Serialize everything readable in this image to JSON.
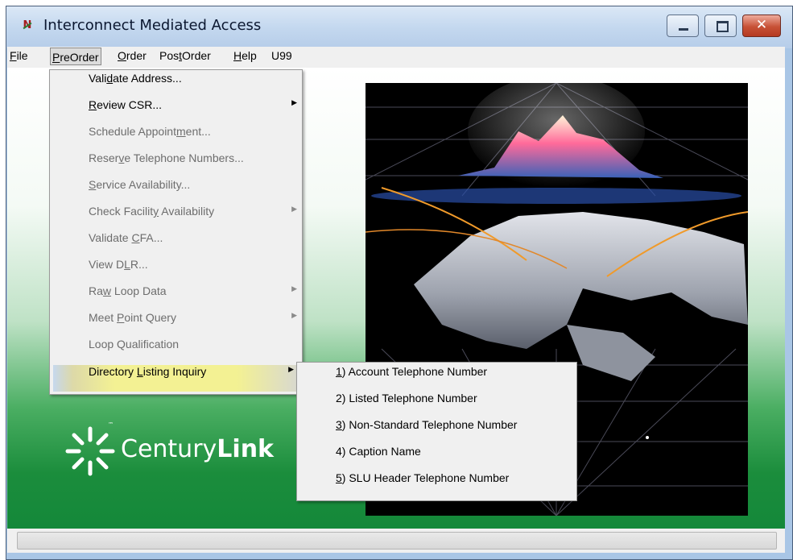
{
  "window": {
    "title": "Interconnect Mediated Access",
    "controls": [
      "minimize-icon",
      "maximize-icon",
      "close-icon"
    ]
  },
  "menubar": {
    "items": [
      {
        "label": "File",
        "mnemonic": "F",
        "rest": "ile"
      },
      {
        "label": "PreOrder",
        "mnemonic": "P",
        "rest": "reOrder",
        "active": true
      },
      {
        "label": "Order",
        "mnemonic": "O",
        "rest": "rder"
      },
      {
        "label": "PostOrder",
        "pre": "Pos",
        "mnemonic": "t",
        "rest": "Order"
      },
      {
        "label": "Help",
        "mnemonic": "H",
        "rest": "elp"
      },
      {
        "label": "U99"
      }
    ]
  },
  "preorder_menu": {
    "items": [
      {
        "pre": "Vali",
        "mn": "d",
        "post": "ate Address...",
        "enabled": true,
        "submenu": false
      },
      {
        "pre": "",
        "mn": "R",
        "post": "eview CSR...",
        "enabled": true,
        "submenu": true
      },
      {
        "pre": "Schedule Appoint",
        "mn": "m",
        "post": "ent...",
        "enabled": false,
        "submenu": false
      },
      {
        "pre": "Reser",
        "mn": "v",
        "post": "e Telephone Numbers...",
        "enabled": false,
        "submenu": false
      },
      {
        "pre": "",
        "mn": "S",
        "post": "ervice Availability...",
        "enabled": false,
        "submenu": false
      },
      {
        "pre": "Check Facilit",
        "mn": "y",
        "post": " Availability",
        "enabled": false,
        "submenu": true
      },
      {
        "pre": "Validate ",
        "mn": "C",
        "post": "FA...",
        "enabled": false,
        "submenu": false
      },
      {
        "pre": "View D",
        "mn": "L",
        "post": "R...",
        "enabled": false,
        "submenu": false
      },
      {
        "pre": "Ra",
        "mn": "w",
        "post": " Loop Data",
        "enabled": false,
        "submenu": true
      },
      {
        "pre": "Meet ",
        "mn": "P",
        "post": "oint Query",
        "enabled": false,
        "submenu": true
      },
      {
        "pre": "Loop Qualification",
        "mn": "",
        "post": "",
        "enabled": false,
        "submenu": false
      },
      {
        "pre": "Directory ",
        "mn": "L",
        "post": "isting Inquiry",
        "enabled": true,
        "submenu": true,
        "highlighted": true
      }
    ]
  },
  "directory_submenu": {
    "items": [
      {
        "mn": "1",
        "post": ") Account Telephone Number"
      },
      {
        "mn": "",
        "post": "2) Listed Telephone Number"
      },
      {
        "mn": "3",
        "post": ") Non-Standard Telephone Number"
      },
      {
        "mn": "",
        "post": "4) Caption Name"
      },
      {
        "mn": "5",
        "post": ") SLU Header Telephone Number"
      }
    ]
  },
  "logo": {
    "text_light": "Century",
    "text_bold": "Link",
    "tm": "™",
    "icon": "centurylink-burst-icon"
  },
  "colors": {
    "titlebar": "#c4d8ef",
    "close_button": "#c75136",
    "menu_background": "#f0f0f0",
    "highlight": "#f3f193",
    "brand_green": "#1b8d3c"
  }
}
